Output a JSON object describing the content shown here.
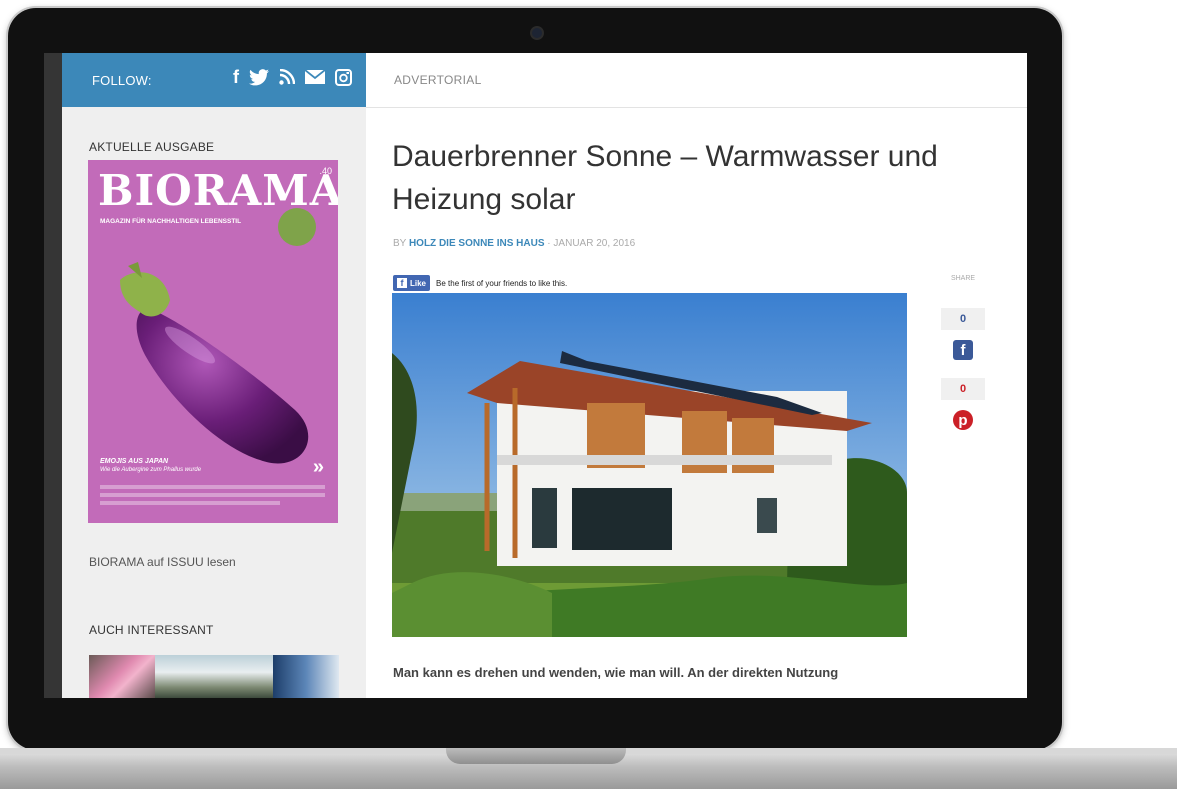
{
  "sidebar": {
    "follow_label": "FOLLOW:",
    "social_icons": [
      "facebook-icon",
      "twitter-icon",
      "rss-icon",
      "mail-icon",
      "instagram-icon"
    ],
    "current_issue_title": "AKTUELLE AUSGABE",
    "cover": {
      "title": "BIORAMA",
      "issue_number": ".40",
      "subtitle": "MAGAZIN FÜR NACHHALTIGEN LEBENSSTIL",
      "headline": "EMOJIS AUS JAPAN",
      "subheadline": "Wie die Aubergine zum Phallus wurde"
    },
    "issuu_link": "BIORAMA auf ISSUU lesen",
    "related_title": "AUCH INTERESSANT"
  },
  "main": {
    "category": "ADVERTORIAL",
    "title": "Dauerbrenner Sonne – Warmwasser und Heizung solar",
    "byline_prefix": "BY",
    "author": "HOLZ DIE SONNE INS HAUS",
    "byline_sep": " · ",
    "date": "JANUAR 20, 2016",
    "fb_like_label": "Like",
    "fb_like_text": "Be the first of your friends to like this.",
    "lead": "Man kann es drehen und wenden, wie man will. An der direkten Nutzung"
  },
  "share": {
    "label": "SHARE",
    "facebook_count": "0",
    "pinterest_count": "0"
  },
  "colors": {
    "accent": "#3c88b9",
    "cover_pink": "#c26bb9",
    "facebook": "#3b5998",
    "pinterest": "#cb2027"
  }
}
